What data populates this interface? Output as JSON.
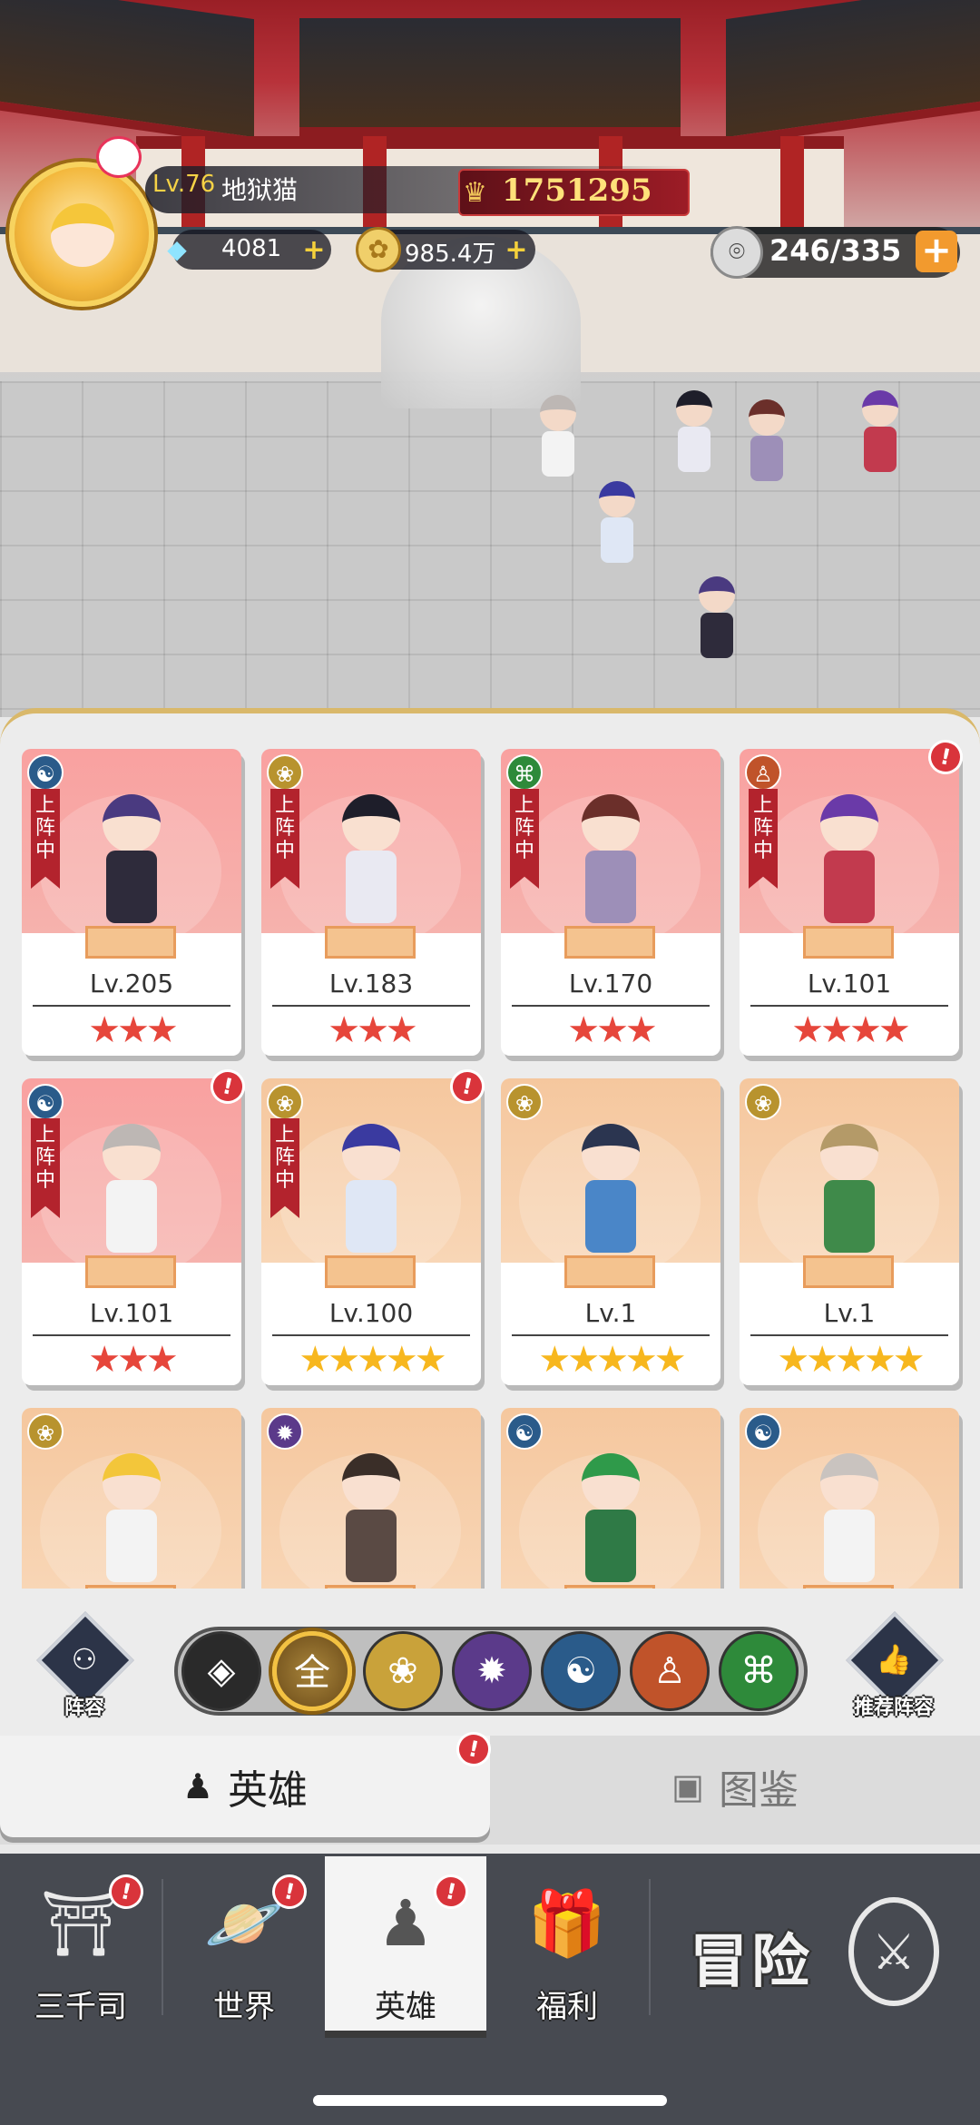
{
  "player": {
    "level_label": "Lv.76",
    "name": "地狱猫",
    "power": "1751295",
    "gems": "4081",
    "gold": "985.4万",
    "stamina": "246/335"
  },
  "icons": {
    "gem": "diamond-icon",
    "gold": "coin-icon",
    "stamina": "energy-icon",
    "power": "crest-icon"
  },
  "heroes": [
    {
      "level": "Lv.205",
      "stars": "★★★",
      "star_color": "red",
      "faction": "water",
      "deployed": true,
      "card": "pink",
      "alert": false
    },
    {
      "level": "Lv.183",
      "stars": "★★★",
      "star_color": "red",
      "faction": "lotus",
      "deployed": true,
      "card": "pink",
      "alert": false
    },
    {
      "level": "Lv.170",
      "stars": "★★★",
      "star_color": "red",
      "faction": "dna",
      "deployed": true,
      "card": "pink",
      "alert": false
    },
    {
      "level": "Lv.101",
      "stars": "★★★★",
      "star_color": "red",
      "faction": "monk",
      "deployed": true,
      "card": "pink",
      "alert": true
    },
    {
      "level": "Lv.101",
      "stars": "★★★",
      "star_color": "red",
      "faction": "water",
      "deployed": true,
      "card": "pink",
      "alert": true
    },
    {
      "level": "Lv.100",
      "stars": "★★★★★",
      "star_color": "yellow",
      "faction": "lotus",
      "deployed": true,
      "card": "gold",
      "alert": true
    },
    {
      "level": "Lv.1",
      "stars": "★★★★★",
      "star_color": "yellow",
      "faction": "lotus",
      "deployed": false,
      "card": "gold",
      "alert": false
    },
    {
      "level": "Lv.1",
      "stars": "★★★★★",
      "star_color": "yellow",
      "faction": "lotus",
      "deployed": false,
      "card": "gold",
      "alert": false
    },
    {
      "level": "",
      "stars": "",
      "star_color": "yellow",
      "faction": "lotus",
      "deployed": false,
      "card": "gold",
      "alert": false
    },
    {
      "level": "",
      "stars": "",
      "star_color": "yellow",
      "faction": "fire",
      "deployed": false,
      "card": "gold",
      "alert": false
    },
    {
      "level": "",
      "stars": "",
      "star_color": "yellow",
      "faction": "water",
      "deployed": false,
      "card": "gold",
      "alert": false
    },
    {
      "level": "",
      "stars": "",
      "star_color": "yellow",
      "faction": "water",
      "deployed": false,
      "card": "gold",
      "alert": false
    }
  ],
  "deployed_label": "上阵中",
  "filters": {
    "lineup_label": "阵容",
    "recommend_label": "推荐阵容",
    "all_label": "全",
    "items": [
      "diamond-filter",
      "all-filter",
      "lotus-filter",
      "fire-filter",
      "water-filter",
      "monk-filter",
      "dna-filter"
    ],
    "colors": [
      "#2a2a2a",
      "#8a6a2a",
      "#c9a23a",
      "#5b3a8a",
      "#2a5b8a",
      "#c0532a",
      "#2e8a3a"
    ]
  },
  "subtabs": {
    "heroes": "英雄",
    "codex": "图鉴"
  },
  "nav": {
    "sanqiansi": "三千司",
    "world": "世界",
    "heroes": "英雄",
    "welfare": "福利",
    "adventure": "冒险"
  },
  "alert_mark": "!"
}
